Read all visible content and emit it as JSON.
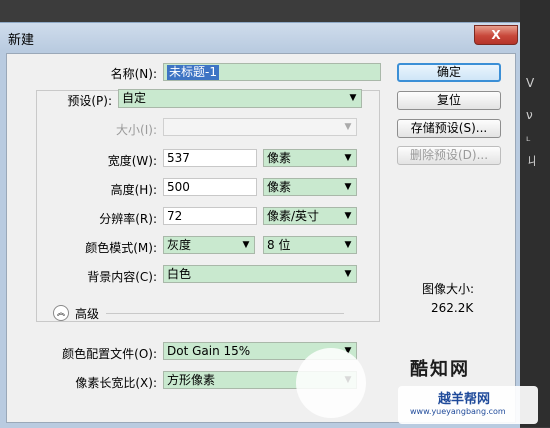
{
  "window": {
    "title": "新建",
    "close_label": "X"
  },
  "background": {
    "side_chars": [
      "V",
      "ν",
      "ᴸ",
      "ㄐ",
      "⊥",
      "̸"
    ]
  },
  "form": {
    "name": {
      "label": "名称(N):",
      "value": "未标题-1"
    },
    "preset": {
      "label": "预设(P):",
      "value": "自定"
    },
    "size": {
      "label": "大小(I):",
      "value": ""
    },
    "width": {
      "label": "宽度(W):",
      "value": "537",
      "unit": "像素"
    },
    "height": {
      "label": "高度(H):",
      "value": "500",
      "unit": "像素"
    },
    "resolution": {
      "label": "分辨率(R):",
      "value": "72",
      "unit": "像素/英寸"
    },
    "color_mode": {
      "label": "颜色模式(M):",
      "value": "灰度",
      "bits": "8 位"
    },
    "background": {
      "label": "背景内容(C):",
      "value": "白色"
    },
    "advanced": {
      "label": "高级"
    },
    "color_profile": {
      "label": "颜色配置文件(O):",
      "value": "Dot Gain 15%"
    },
    "pixel_aspect": {
      "label": "像素长宽比(X):",
      "value": "方形像素"
    }
  },
  "buttons": {
    "ok": "确定",
    "reset": "复位",
    "save_preset": "存储预设(S)...",
    "delete_preset": "删除预设(D)..."
  },
  "image_size": {
    "title": "图像大小:",
    "value": "262.2K"
  },
  "watermark": {
    "site": "酷知网",
    "brand": "越羊帮网",
    "url": "www.yueyangbang.com"
  }
}
